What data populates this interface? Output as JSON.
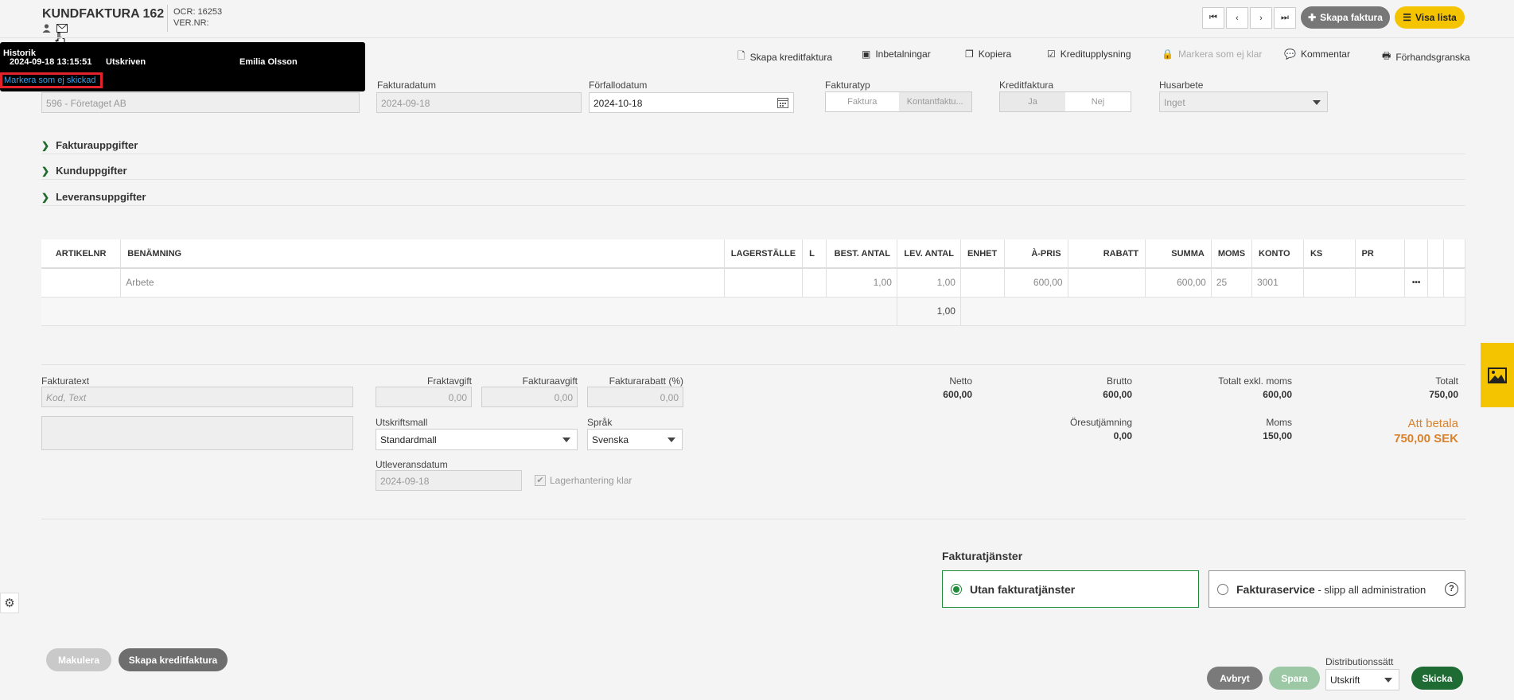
{
  "header": {
    "title": "KUNDFAKTURA 162",
    "ocr": "OCR: 16253",
    "ver": "VER.NR:",
    "create_invoice": "Skapa faktura",
    "show_list": "Visa lista"
  },
  "toolbar": {
    "create_credit": "Skapa kreditfaktura",
    "payments": "Inbetalningar",
    "copy": "Kopiera",
    "credit_check": "Kreditupplysning",
    "mark_unready": "Markera som ej klar",
    "comment": "Kommentar",
    "preview": "Förhandsgranska"
  },
  "history": {
    "heading": "Historik",
    "timestamp": "2024-09-18 13:15:51",
    "status": "Utskriven",
    "user": "Emilia Olsson",
    "mark_not_sent": "Markera som ej skickad"
  },
  "form": {
    "customer_value": "596 - Företaget AB",
    "invoice_date_label": "Fakturadatum",
    "invoice_date": "2024-09-18",
    "due_date_label": "Förfallodatum",
    "due_date": "2024-10-18",
    "invoice_type_label": "Fakturatyp",
    "invoice_type_opt1": "Faktura",
    "invoice_type_opt2": "Kontantfaktu...",
    "credit_label": "Kreditfaktura",
    "credit_yes": "Ja",
    "credit_no": "Nej",
    "house_label": "Husarbete",
    "house_value": "Inget"
  },
  "sections": {
    "invoice_details": "Fakturauppgifter",
    "customer_details": "Kunduppgifter",
    "delivery_details": "Leveransuppgifter"
  },
  "table": {
    "headers": [
      "ARTIKELNR",
      "BENÄMNING",
      "LAGERSTÄLLE",
      "L",
      "BEST. ANTAL",
      "LEV. ANTAL",
      "ENHET",
      "À-PRIS",
      "RABATT",
      "SUMMA",
      "MOMS",
      "KONTO",
      "KS",
      "PR"
    ],
    "row": {
      "artikel": "",
      "benamning": "Arbete",
      "best": "1,00",
      "lev": "1,00",
      "apris": "600,00",
      "summa": "600,00",
      "moms": "25",
      "konto": "3001",
      "more": "•••"
    },
    "total_lev": "1,00"
  },
  "bottom": {
    "invoice_text_label": "Fakturatext",
    "invoice_text_placeholder": "Kod, Text",
    "freight_label": "Fraktavgift",
    "freight": "0,00",
    "invoice_fee_label": "Fakturaavgift",
    "invoice_fee": "0,00",
    "discount_label": "Fakturarabatt (%)",
    "discount": "0,00",
    "template_label": "Utskriftsmall",
    "template": "Standardmall",
    "language_label": "Språk",
    "language": "Svenska",
    "delivery_date_label": "Utleveransdatum",
    "delivery_date": "2024-09-18",
    "stock_label": "Lagerhantering klar"
  },
  "totals": {
    "net_label": "Netto",
    "net": "600,00",
    "gross_label": "Brutto",
    "gross": "600,00",
    "excl_label": "Totalt exkl. moms",
    "excl": "600,00",
    "total_label": "Totalt",
    "total": "750,00",
    "rounding_label": "Öresutjämning",
    "rounding": "0,00",
    "vat_label": "Moms",
    "vat": "150,00",
    "to_pay_label": "Att betala",
    "to_pay": "750,00 SEK"
  },
  "services": {
    "heading": "Fakturatjänster",
    "opt1": "Utan fakturatjänster",
    "opt2": "Fakturaservice",
    "opt2_sub": " - slipp all administration"
  },
  "footer": {
    "cancel_invoice": "Makulera",
    "create_credit": "Skapa kreditfaktura",
    "abort": "Avbryt",
    "save": "Spara",
    "distribution_label": "Distributionssätt",
    "distribution": "Utskrift",
    "send": "Skicka"
  },
  "colors": {
    "accent_yellow": "#f5c400",
    "green": "#1f6b34",
    "orange": "#d9822b"
  }
}
